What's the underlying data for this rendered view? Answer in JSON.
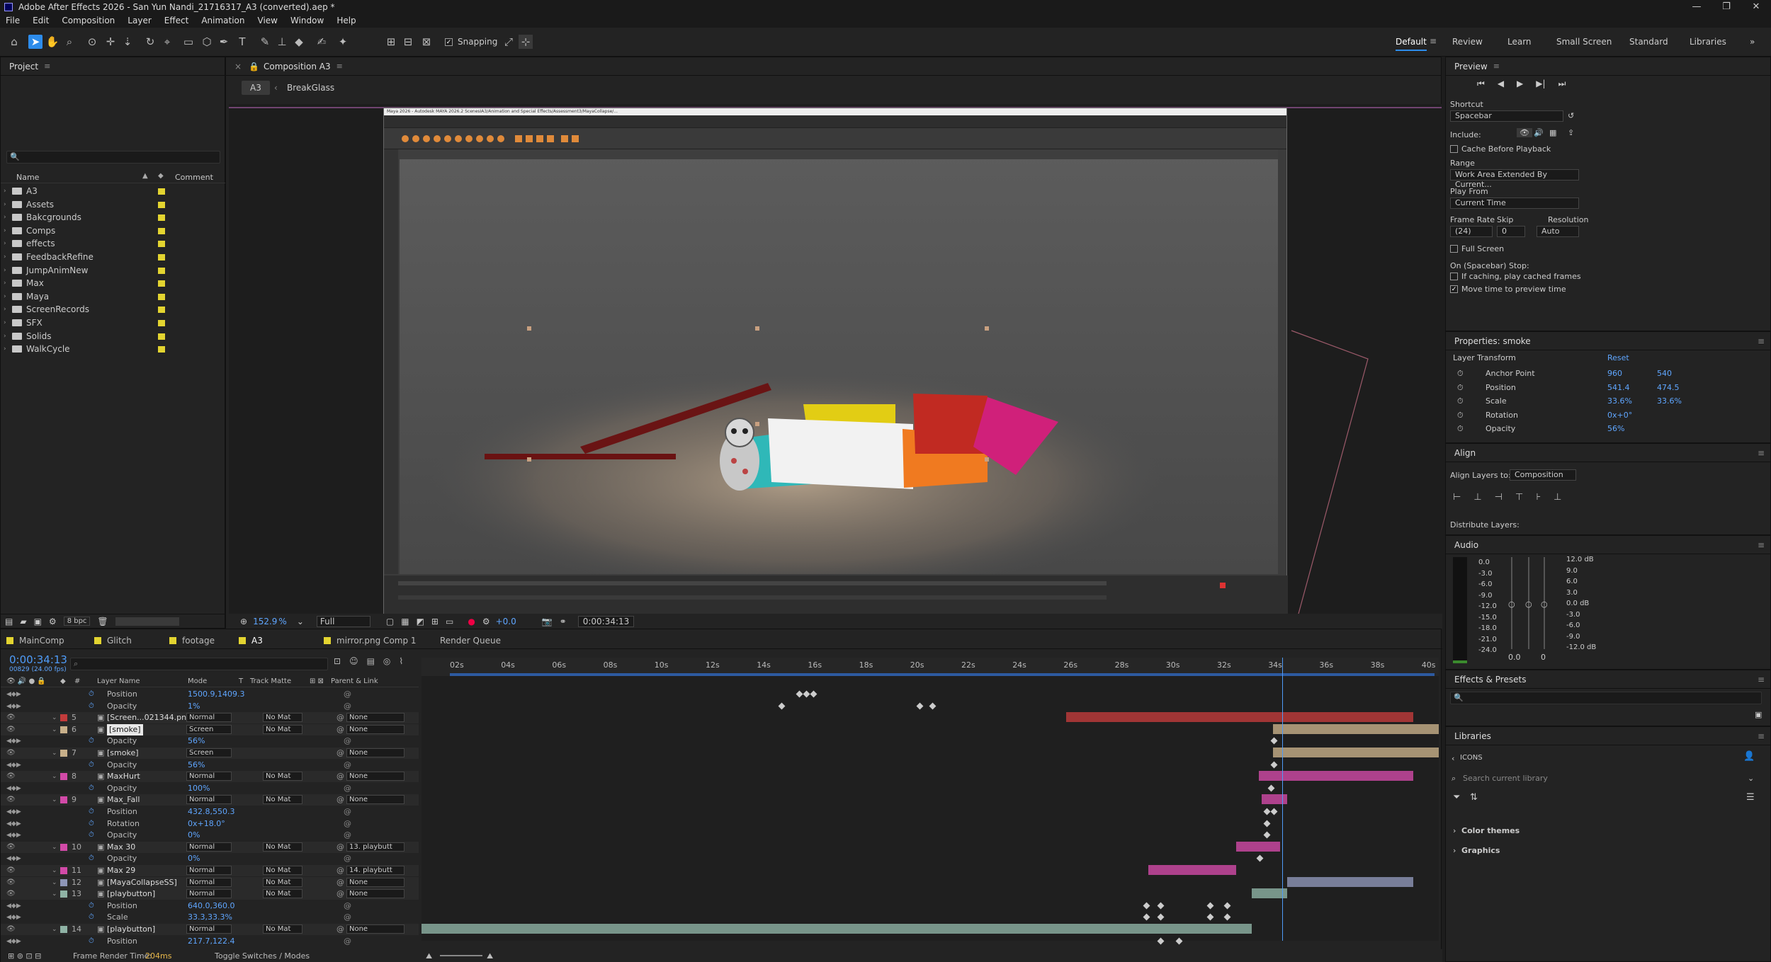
{
  "window": {
    "title": "Adobe After Effects 2026 - San Yun Nandi_21716317_A3 (converted).aep *",
    "controls": [
      "—",
      "❐",
      "✕"
    ]
  },
  "menu": [
    "File",
    "Edit",
    "Composition",
    "Layer",
    "Effect",
    "Animation",
    "View",
    "Window",
    "Help"
  ],
  "toolbar": {
    "snapping_label": "Snapping",
    "snapping_checked": true,
    "workspaces": [
      "Default",
      "Review",
      "Learn",
      "Small Screen",
      "Standard",
      "Libraries"
    ],
    "active_workspace": "Default",
    "more": "»"
  },
  "project": {
    "title": "Project",
    "search_placeholder": "🔍",
    "col_name": "Name",
    "col_comment": "Comment",
    "items": [
      "A3",
      "Assets",
      "Bakcgrounds",
      "Comps",
      "effects",
      "FeedbackRefine",
      "JumpAnimNew",
      "Max",
      "Maya",
      "ScreenRecords",
      "SFX",
      "Solids",
      "WalkCycle"
    ],
    "bpc": "8 bpc",
    "label_color": "#e3d430"
  },
  "composition": {
    "panel_title": "Composition A3",
    "breadcrumb_current": "A3",
    "breadcrumb_prev": "BreakGlass",
    "zoom": "152.9",
    "zoom_unit": "%",
    "resolution": "Full",
    "exposure": "+0.0",
    "timecode": "0:00:34:13"
  },
  "preview": {
    "title": "Preview",
    "shortcut_label": "Shortcut",
    "shortcut_value": "Spacebar",
    "include_label": "Include:",
    "cache_before_playback": "Cache Before Playback",
    "range_label": "Range",
    "range_value": "Work Area Extended By Current...",
    "play_from_label": "Play From",
    "play_from_value": "Current Time",
    "frame_rate_label": "Frame Rate",
    "skip_label": "Skip",
    "resolution_label": "Resolution",
    "frame_rate_value": "(24)",
    "skip_value": "0",
    "resolution_value": "Auto",
    "full_screen": "Full Screen",
    "on_stop_label": "On (Spacebar) Stop:",
    "if_caching": "If caching, play cached frames",
    "move_time": "Move time to preview time"
  },
  "properties": {
    "title": "Properties: smoke",
    "section": "Layer Transform",
    "reset": "Reset",
    "rows": [
      {
        "name": "Anchor Point",
        "v1": "960",
        "v2": "540"
      },
      {
        "name": "Position",
        "v1": "541.4",
        "v2": "474.5"
      },
      {
        "name": "Scale",
        "v1": "33.6%",
        "v2": "33.6%"
      },
      {
        "name": "Rotation",
        "v1": "0x+0°",
        "v2": ""
      },
      {
        "name": "Opacity",
        "v1": "56%",
        "v2": ""
      }
    ]
  },
  "align": {
    "title": "Align",
    "align_to_label": "Align Layers to:",
    "align_to_value": "Composition",
    "distribute_label": "Distribute Layers:"
  },
  "audio": {
    "title": "Audio",
    "left_scale": [
      "0.0",
      "-3.0",
      "-6.0",
      "-9.0",
      "-12.0",
      "-15.0",
      "-18.0",
      "-21.0",
      "-24.0"
    ],
    "right_scale": [
      "12.0 dB",
      "9.0",
      "6.0",
      "3.0",
      "0.0 dB",
      "-3.0",
      "-6.0",
      "-9.0",
      "-12.0 dB"
    ],
    "left_val": "0.0",
    "right_val": "0"
  },
  "effects": {
    "title": "Effects & Presets",
    "search_placeholder": "🔍"
  },
  "libraries": {
    "title": "Libraries",
    "back_label": "ICONS",
    "search_placeholder": "Search current library",
    "sections": [
      "Color themes",
      "Graphics"
    ]
  },
  "timeline": {
    "tabs": [
      "MainComp",
      "Glitch",
      "footage",
      "A3",
      "mirror.png Comp 1",
      "Render Queue"
    ],
    "active_tab": "A3",
    "timecode": "0:00:34:13",
    "frame_info": "00829 (24.00 fps)",
    "col_layer_name": "Layer Name",
    "col_mode": "Mode",
    "col_t": "T",
    "col_track_matte": "Track Matte",
    "col_parent": "Parent & Link",
    "ruler": [
      "02s",
      "04s",
      "06s",
      "08s",
      "10s",
      "12s",
      "14s",
      "16s",
      "18s",
      "20s",
      "22s",
      "24s",
      "26s",
      "28s",
      "30s",
      "32s",
      "34s",
      "36s",
      "38s",
      "40s"
    ],
    "rows": [
      {
        "kind": "prop",
        "name": "Position",
        "value": "1500.9,1409.3"
      },
      {
        "kind": "prop",
        "name": "Opacity",
        "value": "1%"
      },
      {
        "kind": "layer",
        "num": "5",
        "name": "[Screen...021344.png]",
        "mode": "Normal",
        "matte": "No Mat",
        "parent": "None",
        "color": "#c23b3b"
      },
      {
        "kind": "layer",
        "num": "6",
        "name": "[smoke]",
        "mode": "Screen",
        "matte": "No Mat",
        "parent": "None",
        "color": "#c8b08a",
        "selected": true
      },
      {
        "kind": "prop",
        "name": "Opacity",
        "value": "56%"
      },
      {
        "kind": "layer",
        "num": "7",
        "name": "[smoke]",
        "mode": "Screen",
        "matte": "",
        "parent": "None",
        "color": "#c8b08a"
      },
      {
        "kind": "prop",
        "name": "Opacity",
        "value": "56%"
      },
      {
        "kind": "layer",
        "num": "8",
        "name": "MaxHurt",
        "mode": "Normal",
        "matte": "No Mat",
        "parent": "None",
        "color": "#d24aa8"
      },
      {
        "kind": "prop",
        "name": "Opacity",
        "value": "100%"
      },
      {
        "kind": "layer",
        "num": "9",
        "name": "Max_Fall",
        "mode": "Normal",
        "matte": "No Mat",
        "parent": "None",
        "color": "#d24aa8"
      },
      {
        "kind": "prop",
        "name": "Position",
        "value": "432.8,550.3"
      },
      {
        "kind": "prop",
        "name": "Rotation",
        "value": "0x+18.0°"
      },
      {
        "kind": "prop",
        "name": "Opacity",
        "value": "0%"
      },
      {
        "kind": "layer",
        "num": "10",
        "name": "Max 30",
        "mode": "Normal",
        "matte": "No Mat",
        "parent": "13. playbutt",
        "color": "#d24aa8"
      },
      {
        "kind": "prop",
        "name": "Opacity",
        "value": "0%"
      },
      {
        "kind": "layer",
        "num": "11",
        "name": "Max 29",
        "mode": "Normal",
        "matte": "No Mat",
        "parent": "14. playbutt",
        "color": "#d24aa8"
      },
      {
        "kind": "layer",
        "num": "12",
        "name": "[MayaCollapseSS]",
        "mode": "Normal",
        "matte": "No Mat",
        "parent": "None",
        "color": "#8e96b8"
      },
      {
        "kind": "layer",
        "num": "13",
        "name": "[playbutton]",
        "mode": "Normal",
        "matte": "No Mat",
        "parent": "None",
        "color": "#8fb3a5"
      },
      {
        "kind": "prop",
        "name": "Position",
        "value": "640.0,360.0"
      },
      {
        "kind": "prop",
        "name": "Scale",
        "value": "33.3,33.3%"
      },
      {
        "kind": "layer",
        "num": "14",
        "name": "[playbutton]",
        "mode": "Normal",
        "matte": "No Mat",
        "parent": "None",
        "color": "#8fb3a5"
      },
      {
        "kind": "prop",
        "name": "Position",
        "value": "217.7,122.4"
      }
    ],
    "footer_render_label": "Frame Render Time:",
    "footer_render_value": "204ms",
    "footer_toggle": "Toggle Switches / Modes"
  },
  "maya": {
    "title": "Maya 2026 - Autodesk MAYA 2026.2 ScenesIA3/Animation and Special Effects/Assessment3/MayaCollapse/..."
  }
}
